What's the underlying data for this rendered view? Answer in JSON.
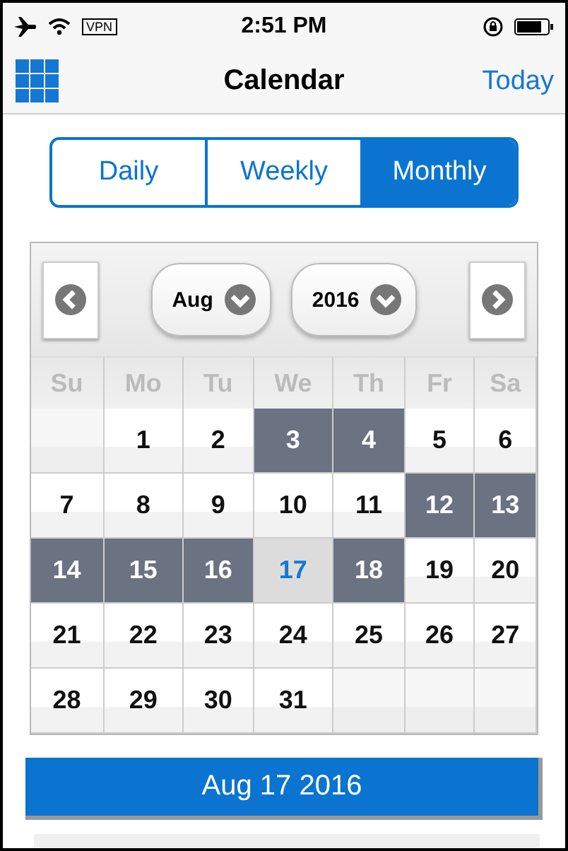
{
  "status_bar": {
    "vpn": "VPN",
    "time": "2:51 PM"
  },
  "nav": {
    "title": "Calendar",
    "action": "Today"
  },
  "segments": [
    {
      "label": "Daily",
      "selected": false
    },
    {
      "label": "Weekly",
      "selected": false
    },
    {
      "label": "Monthly",
      "selected": true
    }
  ],
  "month_picker": {
    "month": "Aug",
    "year": "2016"
  },
  "weekdays": [
    "Su",
    "Mo",
    "Tu",
    "We",
    "Th",
    "Fr",
    "Sa"
  ],
  "weeks": [
    [
      {
        "kind": "blank"
      },
      {
        "kind": "day",
        "day": "1",
        "marked": false,
        "today": false
      },
      {
        "kind": "day",
        "day": "2",
        "marked": false,
        "today": false
      },
      {
        "kind": "day",
        "day": "3",
        "marked": true,
        "today": false
      },
      {
        "kind": "day",
        "day": "4",
        "marked": true,
        "today": false
      },
      {
        "kind": "day",
        "day": "5",
        "marked": false,
        "today": false
      },
      {
        "kind": "day",
        "day": "6",
        "marked": false,
        "today": false
      }
    ],
    [
      {
        "kind": "day",
        "day": "7",
        "marked": false,
        "today": false
      },
      {
        "kind": "day",
        "day": "8",
        "marked": false,
        "today": false
      },
      {
        "kind": "day",
        "day": "9",
        "marked": false,
        "today": false
      },
      {
        "kind": "day",
        "day": "10",
        "marked": false,
        "today": false
      },
      {
        "kind": "day",
        "day": "11",
        "marked": false,
        "today": false
      },
      {
        "kind": "day",
        "day": "12",
        "marked": true,
        "today": false
      },
      {
        "kind": "day",
        "day": "13",
        "marked": true,
        "today": false
      }
    ],
    [
      {
        "kind": "day",
        "day": "14",
        "marked": true,
        "today": false
      },
      {
        "kind": "day",
        "day": "15",
        "marked": true,
        "today": false
      },
      {
        "kind": "day",
        "day": "16",
        "marked": true,
        "today": false
      },
      {
        "kind": "day",
        "day": "17",
        "marked": false,
        "today": true
      },
      {
        "kind": "day",
        "day": "18",
        "marked": true,
        "today": false
      },
      {
        "kind": "day",
        "day": "19",
        "marked": false,
        "today": false
      },
      {
        "kind": "day",
        "day": "20",
        "marked": false,
        "today": false
      }
    ],
    [
      {
        "kind": "day",
        "day": "21",
        "marked": false,
        "today": false
      },
      {
        "kind": "day",
        "day": "22",
        "marked": false,
        "today": false
      },
      {
        "kind": "day",
        "day": "23",
        "marked": false,
        "today": false
      },
      {
        "kind": "day",
        "day": "24",
        "marked": false,
        "today": false
      },
      {
        "kind": "day",
        "day": "25",
        "marked": false,
        "today": false
      },
      {
        "kind": "day",
        "day": "26",
        "marked": false,
        "today": false
      },
      {
        "kind": "day",
        "day": "27",
        "marked": false,
        "today": false
      }
    ],
    [
      {
        "kind": "day",
        "day": "28",
        "marked": false,
        "today": false
      },
      {
        "kind": "day",
        "day": "29",
        "marked": false,
        "today": false
      },
      {
        "kind": "day",
        "day": "30",
        "marked": false,
        "today": false
      },
      {
        "kind": "day",
        "day": "31",
        "marked": false,
        "today": false
      },
      {
        "kind": "blank"
      },
      {
        "kind": "blank"
      },
      {
        "kind": "blank"
      }
    ]
  ],
  "selected_date": "Aug 17 2016"
}
